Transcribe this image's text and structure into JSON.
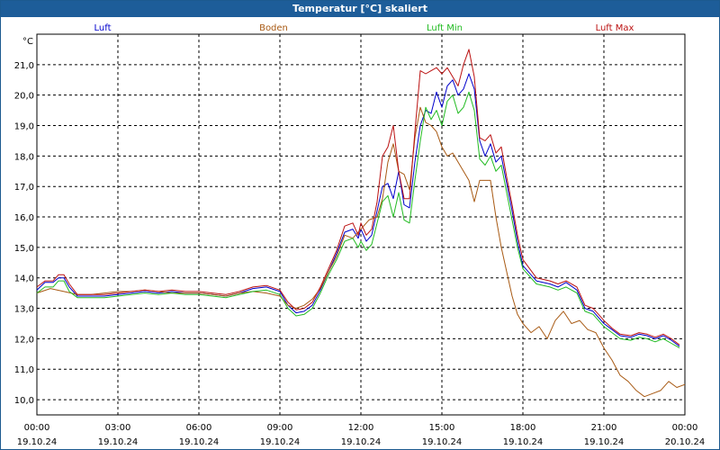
{
  "window": {
    "title": "Temperatur [°C] skaliert"
  },
  "chart_data": {
    "type": "line",
    "title": "Temperatur [°C] skaliert",
    "ylabel": "°C",
    "xlabel": "",
    "ylim": [
      9.5,
      22.0
    ],
    "xlim": [
      0,
      24
    ],
    "grid": true,
    "legend": "top",
    "yticks": [
      "10,0",
      "11,0",
      "12,0",
      "13,0",
      "14,0",
      "15,0",
      "16,0",
      "17,0",
      "18,0",
      "19,0",
      "20,0",
      "21,0"
    ],
    "ytick_values": [
      10,
      11,
      12,
      13,
      14,
      15,
      16,
      17,
      18,
      19,
      20,
      21
    ],
    "xticks": [
      {
        "time": "00:00",
        "date": "19.10.24"
      },
      {
        "time": "03:00",
        "date": "19.10.24"
      },
      {
        "time": "06:00",
        "date": "19.10.24"
      },
      {
        "time": "09:00",
        "date": "19.10.24"
      },
      {
        "time": "12:00",
        "date": "19.10.24"
      },
      {
        "time": "15:00",
        "date": "19.10.24"
      },
      {
        "time": "18:00",
        "date": "19.10.24"
      },
      {
        "time": "21:00",
        "date": "19.10.24"
      },
      {
        "time": "00:00",
        "date": "20.10.24"
      }
    ],
    "xtick_values": [
      0,
      3,
      6,
      9,
      12,
      15,
      18,
      21,
      24
    ],
    "series": [
      {
        "name": "Luft",
        "color": "#0000cc",
        "x": [
          0,
          0.3,
          0.6,
          0.8,
          1.0,
          1.2,
          1.5,
          2,
          2.5,
          3,
          3.5,
          4,
          4.5,
          5,
          5.5,
          6,
          6.5,
          7,
          7.5,
          8,
          8.5,
          9,
          9.3,
          9.6,
          9.9,
          10.2,
          10.5,
          10.8,
          11.1,
          11.4,
          11.7,
          11.9,
          12.0,
          12.2,
          12.4,
          12.6,
          12.8,
          13.0,
          13.2,
          13.4,
          13.6,
          13.8,
          14.0,
          14.2,
          14.4,
          14.6,
          14.8,
          15.0,
          15.2,
          15.4,
          15.6,
          15.8,
          16.0,
          16.2,
          16.4,
          16.6,
          16.8,
          17.0,
          17.2,
          17.4,
          17.6,
          17.8,
          18.0,
          18.5,
          19.0,
          19.3,
          19.6,
          20.0,
          20.3,
          20.6,
          21.0,
          21.3,
          21.6,
          22.0,
          22.3,
          22.6,
          22.9,
          23.2,
          23.5,
          23.8
        ],
        "y": [
          13.6,
          13.85,
          13.85,
          14.0,
          14.0,
          13.7,
          13.4,
          13.4,
          13.4,
          13.45,
          13.5,
          13.55,
          13.5,
          13.55,
          13.5,
          13.5,
          13.45,
          13.4,
          13.5,
          13.65,
          13.7,
          13.55,
          13.1,
          12.85,
          12.9,
          13.1,
          13.6,
          14.2,
          14.8,
          15.5,
          15.6,
          15.3,
          15.6,
          15.2,
          15.4,
          16.2,
          17.0,
          17.1,
          16.6,
          17.5,
          16.4,
          16.3,
          17.8,
          19.0,
          19.5,
          19.4,
          20.1,
          19.6,
          20.3,
          20.5,
          20.0,
          20.2,
          20.7,
          20.2,
          18.5,
          18.0,
          18.4,
          17.8,
          18.0,
          17.1,
          16.2,
          15.2,
          14.4,
          13.9,
          13.8,
          13.7,
          13.85,
          13.6,
          13.0,
          12.9,
          12.5,
          12.3,
          12.1,
          12.05,
          12.15,
          12.1,
          12.0,
          12.1,
          11.95,
          11.75
        ]
      },
      {
        "name": "Boden",
        "color": "#a85a14",
        "x": [
          0,
          0.5,
          1.0,
          1.5,
          2,
          2.5,
          3,
          3.5,
          4,
          4.5,
          5,
          5.5,
          6,
          6.5,
          7,
          7.5,
          8,
          8.5,
          9,
          9.3,
          9.6,
          9.9,
          10.2,
          10.5,
          10.8,
          11.1,
          11.4,
          11.7,
          12.0,
          12.3,
          12.6,
          12.8,
          13.0,
          13.2,
          13.4,
          13.6,
          13.8,
          14.0,
          14.2,
          14.4,
          14.6,
          14.8,
          15.0,
          15.2,
          15.4,
          15.6,
          15.8,
          16.0,
          16.2,
          16.4,
          16.6,
          16.8,
          17.0,
          17.2,
          17.4,
          17.6,
          17.8,
          18.0,
          18.3,
          18.6,
          18.9,
          19.2,
          19.5,
          19.8,
          20.1,
          20.4,
          20.7,
          21.0,
          21.3,
          21.6,
          21.9,
          22.2,
          22.5,
          22.8,
          23.1,
          23.4,
          23.7,
          24.0
        ],
        "y": [
          13.5,
          13.65,
          13.55,
          13.45,
          13.45,
          13.5,
          13.55,
          13.55,
          13.6,
          13.55,
          13.5,
          13.5,
          13.5,
          13.45,
          13.4,
          13.5,
          13.55,
          13.5,
          13.4,
          13.1,
          13.0,
          13.1,
          13.3,
          13.65,
          14.2,
          14.7,
          15.4,
          15.3,
          15.6,
          15.9,
          16.0,
          16.6,
          17.8,
          18.4,
          17.5,
          17.4,
          16.9,
          18.6,
          19.6,
          19.1,
          19.0,
          18.8,
          18.3,
          18.0,
          18.1,
          17.8,
          17.5,
          17.2,
          16.5,
          17.2,
          17.2,
          17.2,
          16.0,
          15.0,
          14.2,
          13.4,
          12.8,
          12.5,
          12.2,
          12.4,
          12.0,
          12.6,
          12.9,
          12.5,
          12.6,
          12.3,
          12.2,
          11.7,
          11.3,
          10.8,
          10.6,
          10.3,
          10.1,
          10.2,
          10.3,
          10.6,
          10.4,
          10.5
        ]
      },
      {
        "name": "Luft Min",
        "color": "#22bb22",
        "x": [
          0,
          0.3,
          0.6,
          0.8,
          1.0,
          1.2,
          1.5,
          2,
          2.5,
          3,
          3.5,
          4,
          4.5,
          5,
          5.5,
          6,
          6.5,
          7,
          7.5,
          8,
          8.5,
          9,
          9.3,
          9.6,
          9.9,
          10.2,
          10.5,
          10.8,
          11.1,
          11.4,
          11.7,
          11.9,
          12.0,
          12.2,
          12.4,
          12.6,
          12.8,
          13.0,
          13.2,
          13.4,
          13.6,
          13.8,
          14.0,
          14.2,
          14.4,
          14.6,
          14.8,
          15.0,
          15.2,
          15.4,
          15.6,
          15.8,
          16.0,
          16.2,
          16.4,
          16.6,
          16.8,
          17.0,
          17.2,
          17.4,
          17.6,
          17.8,
          18.0,
          18.5,
          19.0,
          19.3,
          19.6,
          20.0,
          20.3,
          20.6,
          21.0,
          21.3,
          21.6,
          22.0,
          22.3,
          22.6,
          22.9,
          23.2,
          23.5,
          23.8
        ],
        "y": [
          13.5,
          13.7,
          13.7,
          13.9,
          13.9,
          13.55,
          13.35,
          13.35,
          13.35,
          13.4,
          13.45,
          13.5,
          13.45,
          13.5,
          13.45,
          13.45,
          13.4,
          13.35,
          13.45,
          13.55,
          13.6,
          13.45,
          13.0,
          12.75,
          12.8,
          13.0,
          13.5,
          14.1,
          14.6,
          15.2,
          15.3,
          15.0,
          15.2,
          14.9,
          15.1,
          15.8,
          16.5,
          16.7,
          16.0,
          16.8,
          15.9,
          15.8,
          17.2,
          18.5,
          19.6,
          19.2,
          19.5,
          19.0,
          19.8,
          20.0,
          19.4,
          19.6,
          20.1,
          19.5,
          17.9,
          17.7,
          18.0,
          17.5,
          17.7,
          16.8,
          15.9,
          15.0,
          14.3,
          13.8,
          13.7,
          13.6,
          13.7,
          13.5,
          12.9,
          12.8,
          12.4,
          12.2,
          12.0,
          11.95,
          12.05,
          12.0,
          11.9,
          12.0,
          11.85,
          11.7
        ]
      },
      {
        "name": "Luft Max",
        "color": "#bb1111",
        "x": [
          0,
          0.3,
          0.6,
          0.8,
          1.0,
          1.2,
          1.5,
          2,
          2.5,
          3,
          3.5,
          4,
          4.5,
          5,
          5.5,
          6,
          6.5,
          7,
          7.5,
          8,
          8.5,
          9,
          9.3,
          9.6,
          9.9,
          10.2,
          10.5,
          10.8,
          11.1,
          11.4,
          11.7,
          11.9,
          12.0,
          12.2,
          12.4,
          12.6,
          12.8,
          13.0,
          13.2,
          13.4,
          13.6,
          13.8,
          14.0,
          14.2,
          14.4,
          14.6,
          14.8,
          15.0,
          15.2,
          15.4,
          15.6,
          15.8,
          16.0,
          16.2,
          16.4,
          16.6,
          16.8,
          17.0,
          17.2,
          17.4,
          17.6,
          17.8,
          18.0,
          18.5,
          19.0,
          19.3,
          19.6,
          20.0,
          20.3,
          20.6,
          21.0,
          21.3,
          21.6,
          22.0,
          22.3,
          22.6,
          22.9,
          23.2,
          23.5,
          23.8
        ],
        "y": [
          13.7,
          13.9,
          13.9,
          14.1,
          14.1,
          13.8,
          13.45,
          13.45,
          13.45,
          13.5,
          13.55,
          13.6,
          13.55,
          13.6,
          13.55,
          13.55,
          13.5,
          13.45,
          13.55,
          13.7,
          13.75,
          13.6,
          13.2,
          12.95,
          13.0,
          13.2,
          13.7,
          14.3,
          14.9,
          15.7,
          15.8,
          15.4,
          15.8,
          15.4,
          15.6,
          16.5,
          18.0,
          18.3,
          19.0,
          17.5,
          16.6,
          16.6,
          18.8,
          20.8,
          20.7,
          20.8,
          20.9,
          20.7,
          20.9,
          20.6,
          20.3,
          21.0,
          21.5,
          20.6,
          18.6,
          18.5,
          18.7,
          18.1,
          18.3,
          17.3,
          16.4,
          15.4,
          14.6,
          14.0,
          13.9,
          13.8,
          13.9,
          13.7,
          13.1,
          13.0,
          12.6,
          12.35,
          12.15,
          12.1,
          12.2,
          12.15,
          12.05,
          12.15,
          12.0,
          11.8
        ]
      }
    ]
  }
}
